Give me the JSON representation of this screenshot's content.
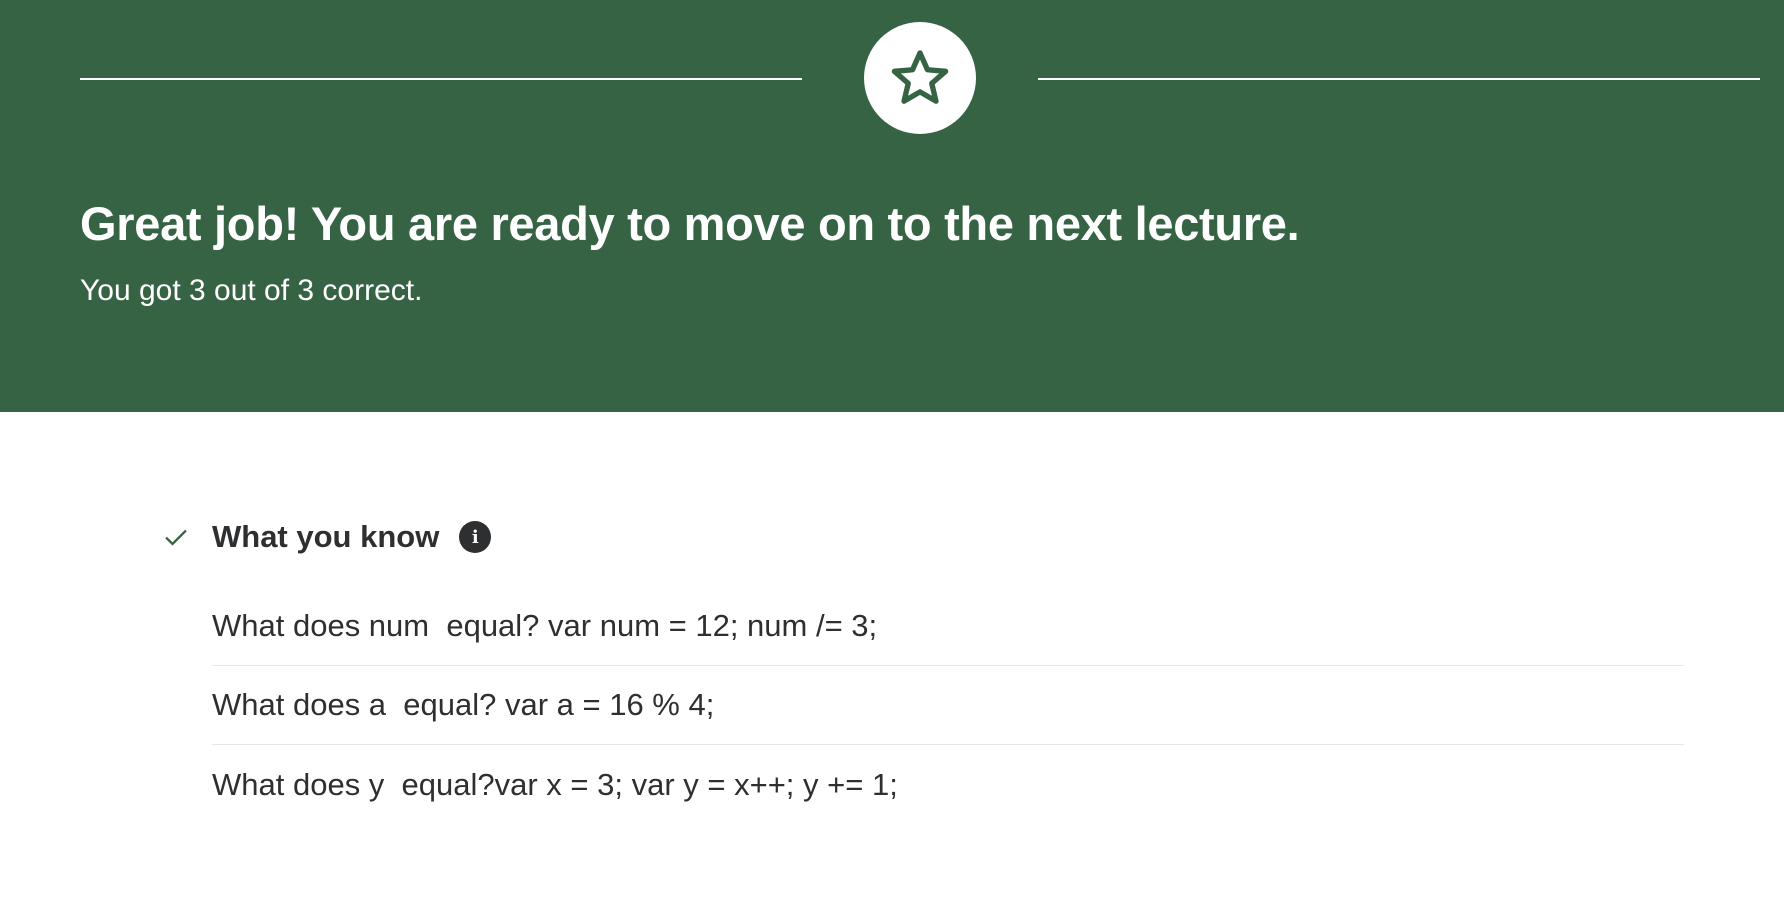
{
  "banner": {
    "badge_icon": "star-icon",
    "headline": "Great job! You are ready to move on to the next lecture.",
    "score_text": "You got 3 out of 3 correct.",
    "background_color": "#356344"
  },
  "summary": {
    "section_icon": "check-icon",
    "section_title": "What you know",
    "info_icon": "info-icon",
    "info_glyph": "i",
    "questions": [
      "What does num  equal? var num = 12; num /= 3;",
      "What does a  equal? var a = 16 % 4;",
      "What does y  equal?var x = 3; var y = x++; y += 1;"
    ]
  }
}
